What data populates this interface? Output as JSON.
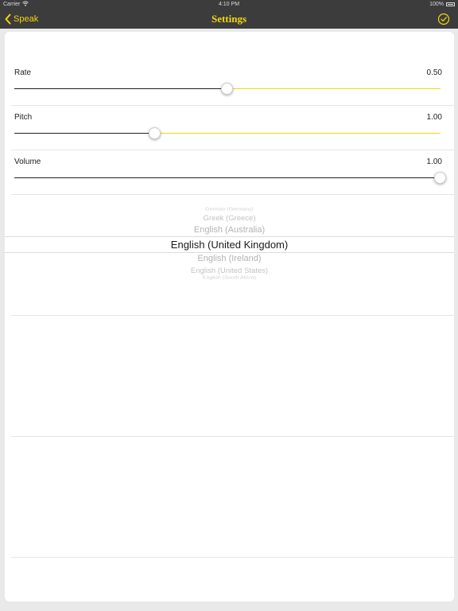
{
  "statusbar": {
    "carrier": "Carrier",
    "time": "4:10 PM",
    "battery": "100%"
  },
  "navbar": {
    "back_label": "Speak",
    "title": "Settings"
  },
  "settings": {
    "rate": {
      "label": "Rate",
      "value": "0.50",
      "fraction": 0.5
    },
    "pitch": {
      "label": "Pitch",
      "value": "1.00",
      "fraction": 0.33
    },
    "volume": {
      "label": "Volume",
      "value": "1.00",
      "fraction": 1.0
    }
  },
  "picker": {
    "options": [
      "German (Germany)",
      "Greek (Greece)",
      "English (Australia)",
      "English (United Kingdom)",
      "English (Ireland)",
      "English (United States)",
      "English (South Africa)"
    ],
    "selected": "English (United Kingdom)"
  },
  "colors": {
    "accent": "#f5d60e",
    "bar": "#3c3c3c"
  }
}
